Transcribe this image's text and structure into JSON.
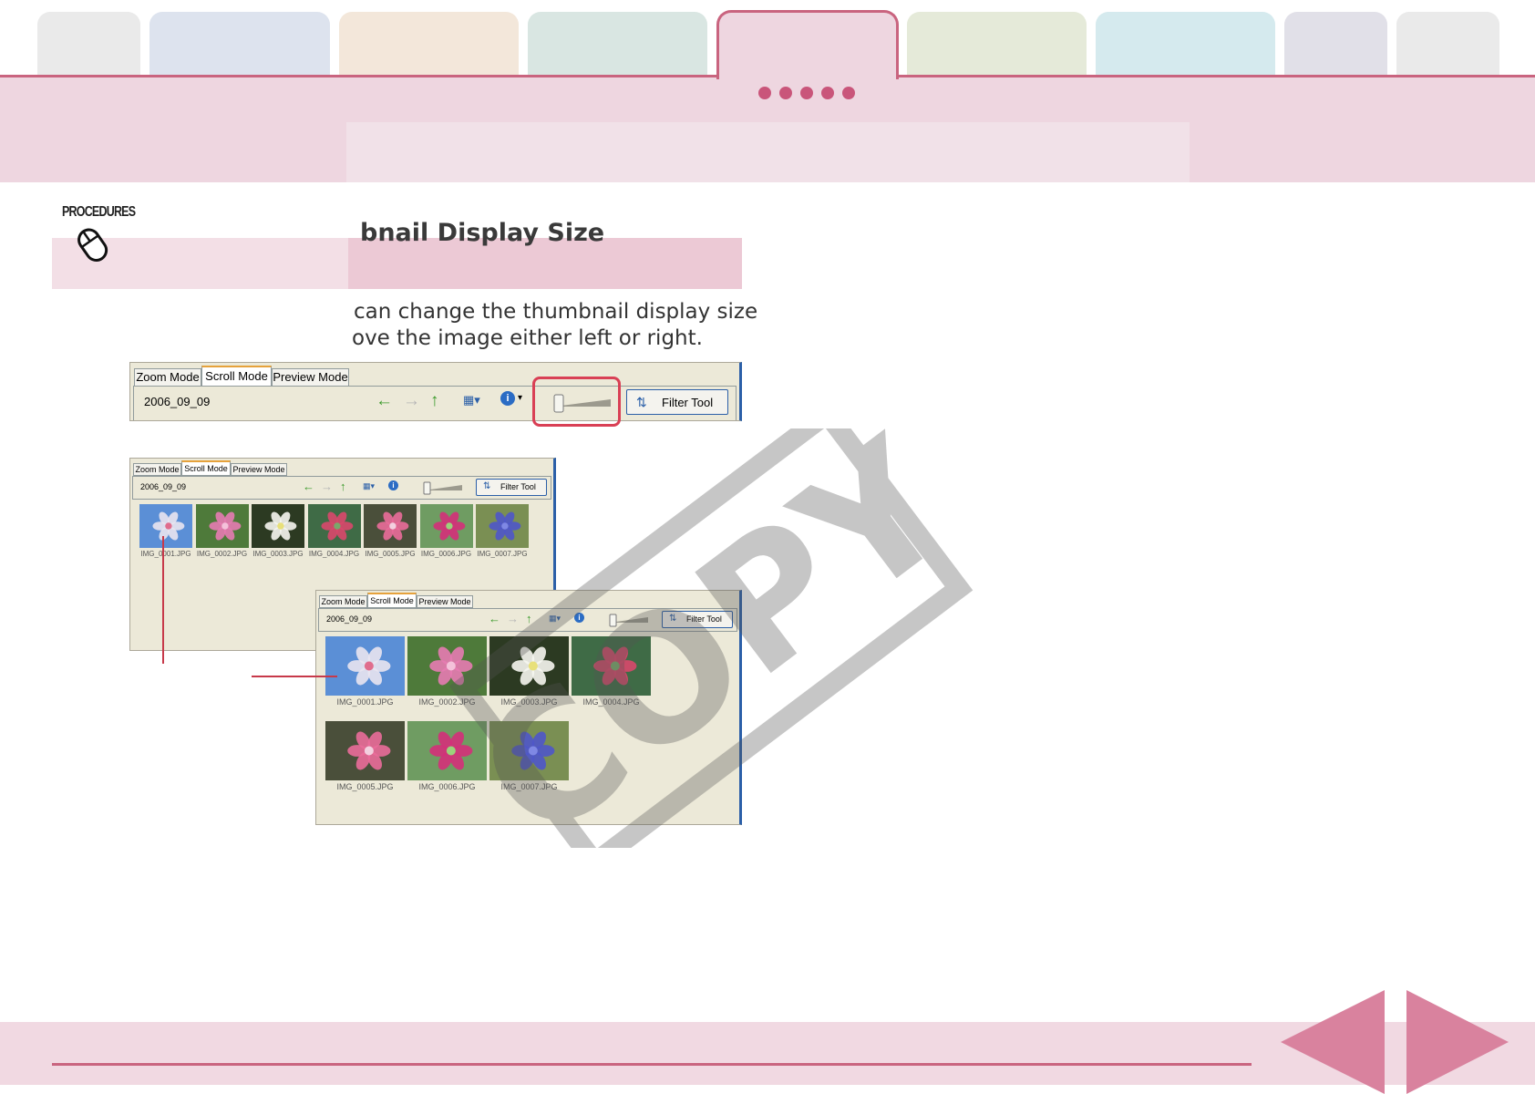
{
  "tabs_colors": [
    "#eaeaea",
    "#dde3ee",
    "#f3e7da",
    "#d9e6e2",
    "#eed6e0",
    "#e5ead9",
    "#d5eaee",
    "#e1e0e8",
    "#eaeaea"
  ],
  "procedure": {
    "label": "PROCEDURES",
    "heading": "bnail Display Size",
    "body_line1": "can change the thumbnail display size",
    "body_line2": "ove the image either left or right."
  },
  "toolbar_large": {
    "tabs": [
      "Zoom Mode",
      "Scroll Mode",
      "Preview Mode"
    ],
    "folder": "2006_09_09",
    "filter_label": "Filter Tool",
    "slider_level": 0.0
  },
  "window_small": {
    "tabs": [
      "Zoom Mode",
      "Scroll Mode",
      "Preview Mode"
    ],
    "folder": "2006_09_09",
    "filter_label": "Filter Tool",
    "thumbnails": [
      "IMG_0001.JPG",
      "IMG_0002.JPG",
      "IMG_0003.JPG",
      "IMG_0004.JPG",
      "IMG_0005.JPG",
      "IMG_0006.JPG",
      "IMG_0007.JPG"
    ]
  },
  "window_large": {
    "tabs": [
      "Zoom Mode",
      "Scroll Mode",
      "Preview Mode"
    ],
    "folder": "2006_09_09",
    "filter_label": "Filter Tool",
    "thumbnails": [
      "IMG_0001.JPG",
      "IMG_0002.JPG",
      "IMG_0003.JPG",
      "IMG_0004.JPG",
      "IMG_0005.JPG",
      "IMG_0006.JPG",
      "IMG_0007.JPG"
    ]
  },
  "watermark": "COPY",
  "accent": "#c9647f"
}
